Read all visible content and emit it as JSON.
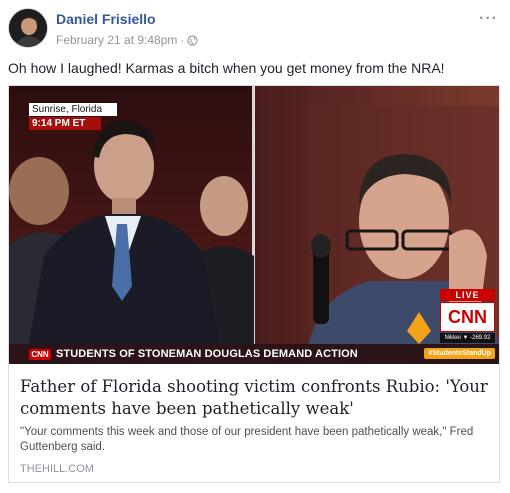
{
  "post": {
    "author": "Daniel Frisiello",
    "timestamp": "February 21 at 9:48pm",
    "separator": "·",
    "more_label": "···",
    "status_text": "Oh how I laughed! Karmas a bitch when you get money from the NRA!"
  },
  "link_card": {
    "title": "Father of Florida shooting victim confronts Rubio: 'Your comments have been pathetically weak'",
    "description": "\"Your comments this week and those of our president have been pathetically weak,\" Fred Guttenberg said.",
    "domain": "THEHILL.COM"
  },
  "broadcast": {
    "location": "Sunrise, Florida",
    "time": "9:14 PM ET",
    "chyron_logo": "CNN",
    "chyron_text": "STUDENTS OF STONEMAN DOUGLAS DEMAND ACTION",
    "hashtag": "#StudentsStandUp",
    "live_label": "LIVE",
    "network_logo": "CNN",
    "ticker_text": "Nikkei ▼ -269.92"
  },
  "colors": {
    "link_blue": "#365899",
    "meta_gray": "#90949c",
    "cnn_red": "#cc0000"
  }
}
